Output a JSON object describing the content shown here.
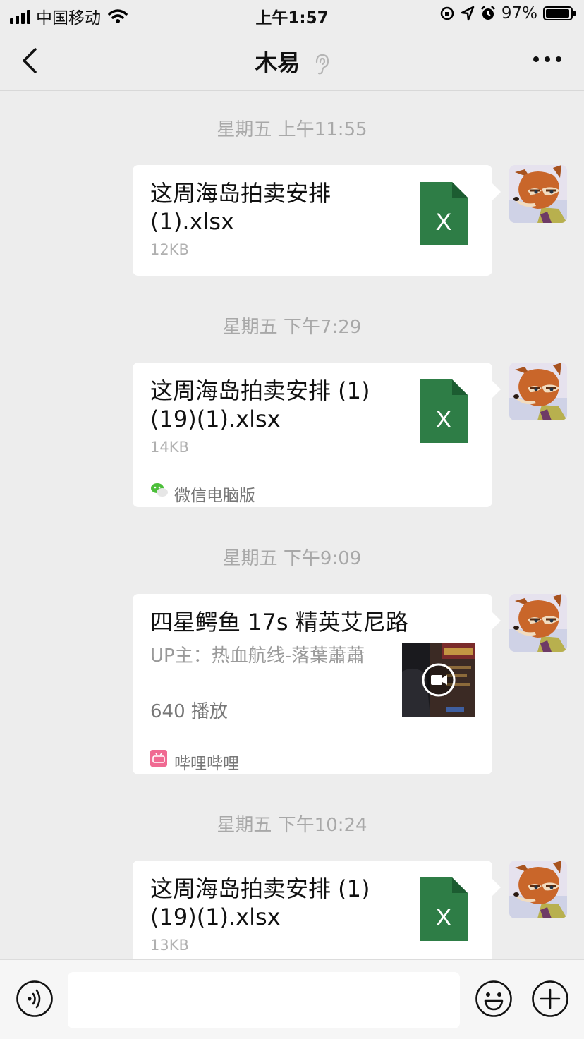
{
  "status_bar": {
    "carrier": "中国移动",
    "time": "上午1:57",
    "battery": "97%",
    "battery_level": 0.97,
    "icons": [
      "signal-icon",
      "wifi-icon",
      "orientation-lock-icon",
      "location-icon",
      "alarm-icon",
      "battery-icon"
    ]
  },
  "nav": {
    "title": "木易",
    "icons": [
      "back-icon",
      "ear-icon",
      "more-icon"
    ]
  },
  "messages": [
    {
      "timestamp": "星期五 上午11:55",
      "type": "file",
      "file_name": "这周海岛拍卖安排(1).xlsx",
      "file_size": "12KB",
      "file_icon_letter": "X"
    },
    {
      "timestamp": "星期五 下午7:29",
      "type": "file",
      "file_name": "这周海岛拍卖安排 (1)(19)(1).xlsx",
      "file_size": "14KB",
      "file_icon_letter": "X",
      "source": "微信电脑版"
    },
    {
      "timestamp": "星期五 下午9:09",
      "type": "video_link",
      "title": "四星鳄鱼 17s 精英艾尼路",
      "uploader": "UP主：热血航线-落葉蕭蕭",
      "plays": "640 播放",
      "source": "哔哩哔哩"
    },
    {
      "timestamp": "星期五 下午10:24",
      "type": "file",
      "file_name": "这周海岛拍卖安排 (1)(19)(1).xlsx",
      "file_size": "13KB",
      "file_icon_letter": "X"
    }
  ],
  "input_bar": {
    "placeholder": "",
    "icons": [
      "voice-icon",
      "emoji-icon",
      "plus-icon"
    ]
  },
  "colors": {
    "background": "#ededed",
    "bubble": "#ffffff",
    "excel_green": "#2e7d46",
    "timestamp_text": "#a8a8a8",
    "bilibili_pink": "#f06a92"
  }
}
